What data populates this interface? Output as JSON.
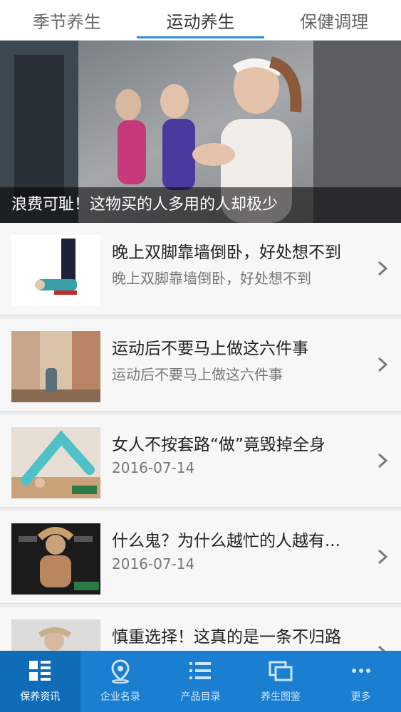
{
  "tabs": [
    {
      "label": "季节养生"
    },
    {
      "label": "运动养生"
    },
    {
      "label": "保健调理"
    }
  ],
  "hero": {
    "caption": "浪费可耻！这物买的人多用的人却极少"
  },
  "articles": [
    {
      "title": "晚上双脚靠墙倒卧，好处想不到",
      "subtitle": "晚上双脚靠墙倒卧，好处想不到"
    },
    {
      "title": "运动后不要马上做这六件事",
      "subtitle": "运动后不要马上做这六件事"
    },
    {
      "title": "女人不按套路“做”竟毁掉全身",
      "subtitle": "2016-07-14"
    },
    {
      "title": "什么鬼？为什么越忙的人越有...",
      "subtitle": "2016-07-14"
    },
    {
      "title": "慎重选择！这真的是一条不归路",
      "subtitle": ""
    }
  ],
  "bottom_nav": [
    {
      "label": "保养资讯",
      "icon": "list-grid-icon"
    },
    {
      "label": "企业名录",
      "icon": "map-pin-icon"
    },
    {
      "label": "产品目录",
      "icon": "list-icon"
    },
    {
      "label": "养生图鉴",
      "icon": "gallery-icon"
    },
    {
      "label": "更多",
      "icon": "more-dots-icon"
    }
  ],
  "colors": {
    "nav_bg": "#1a7fd1",
    "nav_active": "#0f6cb7",
    "tab_underline": "#2b90d9"
  }
}
